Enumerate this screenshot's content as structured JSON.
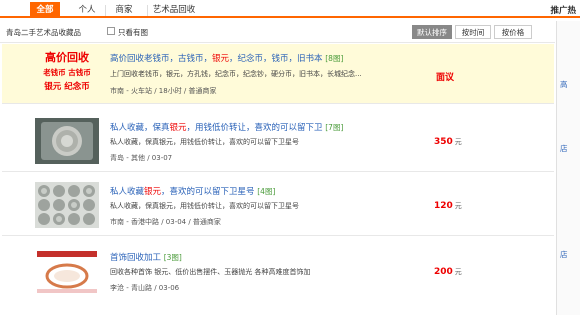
{
  "tabs": [
    {
      "label": "全部",
      "active": true
    },
    {
      "label": "个人",
      "active": false
    },
    {
      "label": "商家",
      "active": false
    },
    {
      "label": "艺术品回收",
      "active": false
    }
  ],
  "promo": "推广热",
  "filter": {
    "category": "青岛二手艺术品收藏品",
    "image_only_label": "只看有图",
    "sorts": [
      {
        "label": "默认排序",
        "active": true
      },
      {
        "label": "按时间",
        "active": false
      },
      {
        "label": "按价格",
        "active": false
      }
    ]
  },
  "listings": [
    {
      "title": "高价回收老钱币，古钱币，",
      "title_red": "银元",
      "title_rest": "，纪念币，钱币，旧书本",
      "img_count": "[8图]",
      "desc": "上门回收老钱币，银元，方孔钱，纪念币，纪念钞，硬分币，旧书本，长城纪念...",
      "meta": "市南 - 火车站 / 18小时 / 普通商家",
      "price": "面议",
      "unit": "",
      "thumb_lines": [
        "高价回收",
        "老钱币 古钱币",
        "银元 纪念币"
      ]
    },
    {
      "title": "私人收藏，保真",
      "title_red": "银元",
      "title_rest": "，用钱低价转让，喜欢的可以留下卫",
      "img_count": "[7图]",
      "desc": "私人收藏，保真银元，用钱低价转让，喜欢的可以留下卫星号",
      "meta": "青岛 - 其他 / 03-07",
      "price": "350",
      "unit": "元"
    },
    {
      "title": "私人收藏",
      "title_red": "银元",
      "title_rest": "，喜欢的可以留下卫星号",
      "img_count": "[4图]",
      "desc": "私人收藏，保真银元，用钱低价转让，喜欢的可以留下卫星号",
      "meta": "市南 - 香港中路 / 03-04 / 普通商家",
      "price": "120",
      "unit": "元"
    },
    {
      "title": "首饰回收加工",
      "title_red": "",
      "title_rest": "",
      "img_count": "[3图]",
      "desc": "回收各种首饰 银元、低价出售摆件、玉器抛光 各种高难度首饰加",
      "meta": "李沧 - 青山路 / 03-06",
      "price": "200",
      "unit": "元"
    }
  ],
  "side_links": [
    "高",
    "店",
    "店"
  ],
  "colors": {
    "accent": "#ff6600",
    "link": "#2a62b8",
    "price": "#e00000",
    "highlight": "#fffbd9"
  }
}
